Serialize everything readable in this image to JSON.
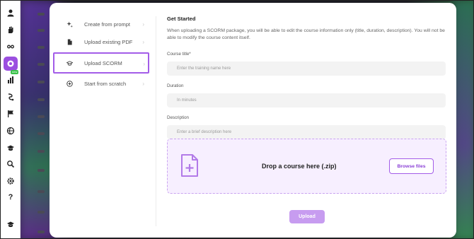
{
  "rail": {
    "new_badge": "new",
    "icons": [
      "person-icon",
      "hand-icon",
      "link-icon",
      "rocket-icon",
      "chart-icon",
      "route-icon",
      "flag-icon",
      "globe-icon",
      "graduation-cap-icon",
      "search-icon",
      "gear-icon",
      "help-icon",
      "graduation-cap-icon"
    ],
    "accent_color": "#9b4fe0"
  },
  "menu": {
    "items": [
      {
        "label": "Create from prompt",
        "icon": "sparkle-icon"
      },
      {
        "label": "Upload existing PDF",
        "icon": "file-icon"
      },
      {
        "label": "Upload SCORM",
        "icon": "graduation-cap-icon"
      },
      {
        "label": "Start from scratch",
        "icon": "plus-circle-icon"
      }
    ],
    "active_index": 2
  },
  "content": {
    "title": "Get Started",
    "description": "When uploading a SCORM package, you will be able to edit the course information only (title, duration, description). You will not be able to modify the course content itself.",
    "fields": {
      "course_title": {
        "label": "Course title*",
        "placeholder": "Enter the training name here"
      },
      "duration": {
        "label": "Duration",
        "placeholder": "In minutes"
      },
      "description": {
        "label": "Description",
        "placeholder": "Enter a brief description here"
      }
    },
    "dropzone": {
      "text": "Drop a course here (.zip)",
      "browse_label": "Browse files"
    },
    "upload_label": "Upload"
  }
}
